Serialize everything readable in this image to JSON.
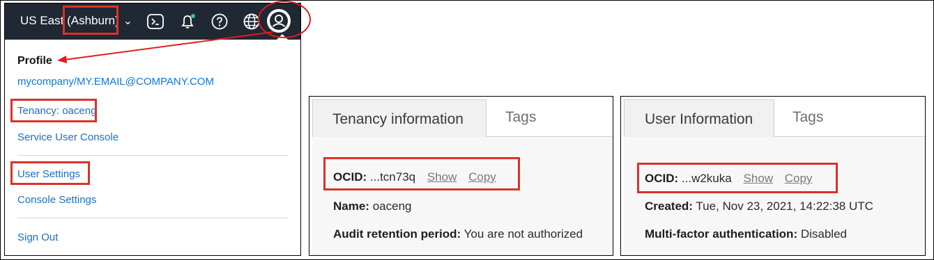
{
  "header": {
    "region": "US East (Ashburn)",
    "icons": [
      "terminal-icon",
      "bell-icon",
      "help-icon",
      "globe-icon",
      "user-icon"
    ],
    "bg_color": "#1f2833"
  },
  "profile_menu": {
    "title": "Profile",
    "user": "mycompany/MY.EMAIL@COMPANY.COM",
    "tenancy": "Tenancy: oaceng",
    "service_console": "Service User Console",
    "user_settings": "User Settings",
    "console_settings": "Console Settings",
    "sign_out": "Sign Out"
  },
  "tenancy_panel": {
    "tabs": [
      "Tenancy information",
      "Tags"
    ],
    "ocid_label": "OCID:",
    "ocid_value": "...tcn73q",
    "show": "Show",
    "copy": "Copy",
    "name_label": "Name:",
    "name_value": "oaceng",
    "audit_label": "Audit retention period:",
    "audit_value": "You are not authorized"
  },
  "user_panel": {
    "tabs": [
      "User Information",
      "Tags"
    ],
    "ocid_label": "OCID:",
    "ocid_value": "...w2kuka",
    "show": "Show",
    "copy": "Copy",
    "created_label": "Created:",
    "created_value": "Tue, Nov 23, 2021, 14:22:38 UTC",
    "mfa_label": "Multi-factor authentication:",
    "mfa_value": "Disabled"
  },
  "colors": {
    "highlight": "#d9322a",
    "link": "#1a6ec4"
  }
}
